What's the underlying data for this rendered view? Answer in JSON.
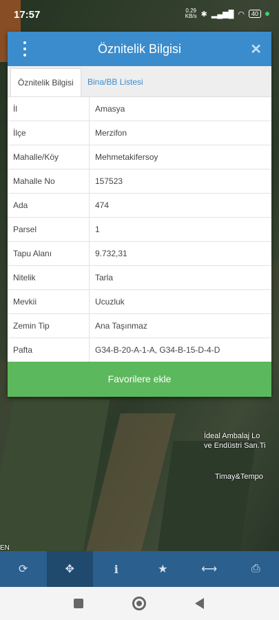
{
  "status": {
    "time": "17:57",
    "net_speed": "0.29\nKB/s",
    "battery": "40"
  },
  "dialog": {
    "title": "Öznitelik Bilgisi",
    "tabs": [
      {
        "label": "Öznitelik Bilgisi"
      },
      {
        "label": "Bina/BB Listesi"
      }
    ],
    "rows": [
      {
        "key": "İl",
        "value": "Amasya"
      },
      {
        "key": "İlçe",
        "value": "Merzifon"
      },
      {
        "key": "Mahalle/Köy",
        "value": "Mehmetakifersoy"
      },
      {
        "key": "Mahalle No",
        "value": "157523"
      },
      {
        "key": "Ada",
        "value": "474"
      },
      {
        "key": "Parsel",
        "value": "1"
      },
      {
        "key": "Tapu Alanı",
        "value": "9.732,31"
      },
      {
        "key": "Nitelik",
        "value": "Tarla"
      },
      {
        "key": "Mevkii",
        "value": "Ucuzluk"
      },
      {
        "key": "Zemin Tip",
        "value": "Ana Taşınmaz"
      },
      {
        "key": "Pafta",
        "value": "G34-B-20-A-1-A, G34-B-15-D-4-D"
      }
    ],
    "favorite_label": "Favorilere ekle"
  },
  "map": {
    "label_1": "İdeal Ambalaj Lo\nve Endüstri San.Ti",
    "label_2": "Timay&Tempo",
    "label_3": "EN"
  },
  "colors": {
    "header": "#3a8ccc",
    "favorite": "#5cb85c",
    "toolbar": "#2a5f8e"
  }
}
